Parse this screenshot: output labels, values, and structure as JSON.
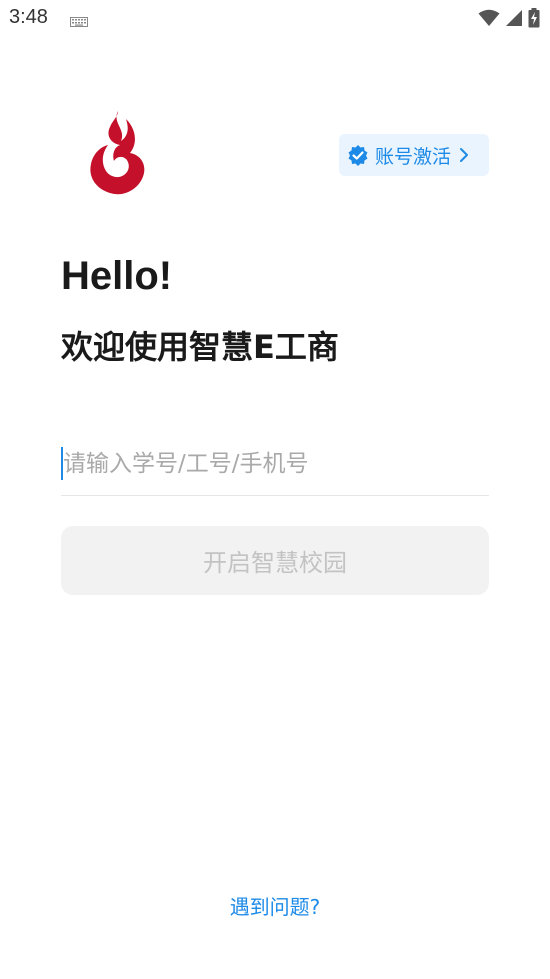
{
  "status_bar": {
    "time": "3:48",
    "icons": [
      "keyboard-icon",
      "wifi-icon",
      "signal-icon",
      "battery-charging-icon"
    ]
  },
  "header": {
    "logo_icon": "flame-logo-icon",
    "activate_button": {
      "label": "账号激活",
      "icon": "verified-badge-icon",
      "chevron": "chevron-right-icon"
    }
  },
  "greeting": {
    "title": "Hello!",
    "subtitle": "欢迎使用智慧E工商"
  },
  "login": {
    "account_input": {
      "placeholder": "请输入学号/工号/手机号",
      "value": ""
    },
    "submit_label": "开启智慧校园"
  },
  "footer": {
    "help_label": "遇到问题?"
  },
  "colors": {
    "accent": "#1d8ae8",
    "activate_bg": "#e9f4fe",
    "logo_red": "#c4102a",
    "button_disabled_bg": "#f2f2f2",
    "button_disabled_text": "#c3c3c3"
  }
}
